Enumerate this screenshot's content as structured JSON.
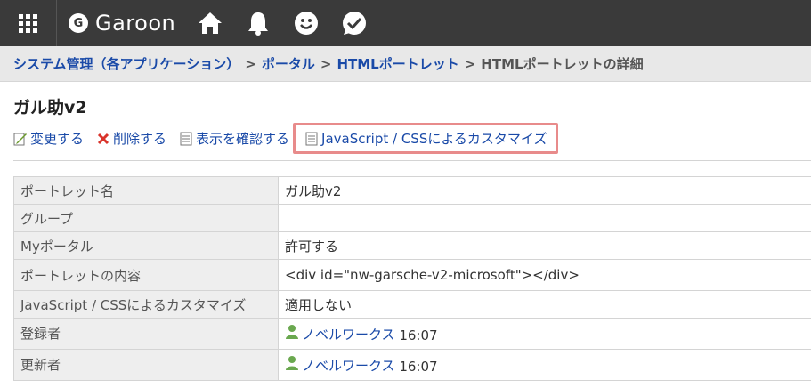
{
  "app": {
    "name": "Garoon",
    "logo_letter": "G"
  },
  "topbar": {
    "icons": [
      "app-grid-icon",
      "home-icon",
      "bell-icon",
      "smiley-icon",
      "checked-bubble-icon"
    ]
  },
  "breadcrumb": {
    "items": [
      "システム管理（各アプリケーション）",
      "ポータル",
      "HTMLポートレット"
    ],
    "current": "HTMLポートレットの詳細",
    "separator": ">"
  },
  "page": {
    "title": "ガル助v2",
    "actions": {
      "edit": "変更する",
      "delete": "削除する",
      "preview": "表示を確認する",
      "customize": "JavaScript / CSSによるカスタマイズ"
    }
  },
  "details": {
    "rows": [
      {
        "key": "ポートレット名",
        "value": "ガル助v2"
      },
      {
        "key": "グループ",
        "value": ""
      },
      {
        "key": "Myポータル",
        "value": "許可する"
      },
      {
        "key": "ポートレットの内容",
        "value": "<div id=\"nw-garsche-v2-microsoft\"></div>"
      },
      {
        "key": "JavaScript / CSSによるカスタマイズ",
        "value": "適用しない"
      },
      {
        "key": "登録者",
        "user": "ノベルワークス",
        "time": "16:07"
      },
      {
        "key": "更新者",
        "user": "ノベルワークス",
        "time": "16:07"
      }
    ]
  },
  "colors": {
    "topbar": "#3a3a3a",
    "link": "#1a4aa8",
    "highlight_border": "#e88b8b"
  }
}
